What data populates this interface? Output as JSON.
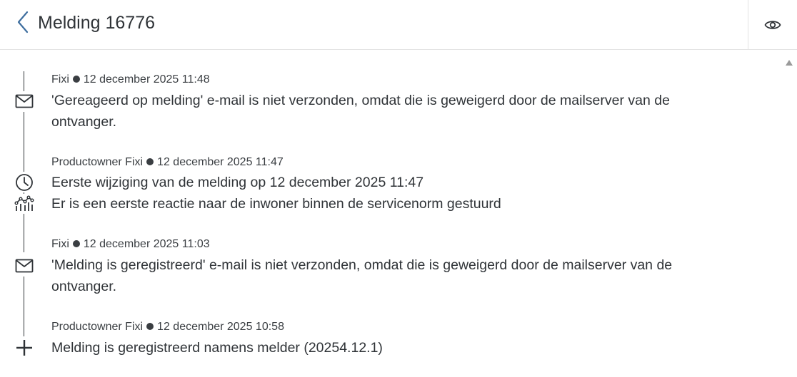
{
  "header": {
    "title": "Melding 16776",
    "back_icon": "chevron-left-icon",
    "watch_icon": "eye-icon",
    "accent_color": "#3d6d9e"
  },
  "timeline": {
    "entries": [
      {
        "author": "Fixi",
        "timestamp": "12 december 2025 11:48",
        "icon": "mail-icon",
        "lines": [
          "'Gereageerd op melding' e-mail is niet verzonden, omdat die is geweigerd door de mailserver van de ontvanger."
        ]
      },
      {
        "author": "Productowner Fixi",
        "timestamp": "12 december 2025 11:47",
        "icons": [
          "clock-icon",
          "chart-icon"
        ],
        "lines": [
          "Eerste wijziging van de melding op 12 december 2025 11:47",
          "Er is een eerste reactie naar de inwoner binnen de servicenorm gestuurd"
        ]
      },
      {
        "author": "Fixi",
        "timestamp": "12 december 2025 11:03",
        "icon": "mail-icon",
        "lines": [
          "'Melding is geregistreerd' e-mail is niet verzonden, omdat die is geweigerd door de mailserver van de ontvanger."
        ]
      },
      {
        "author": "Productowner Fixi",
        "timestamp": "12 december 2025 10:58",
        "icon": "plus-icon",
        "lines": [
          "Melding is geregistreerd namens melder (20254.12.1)"
        ]
      }
    ]
  }
}
